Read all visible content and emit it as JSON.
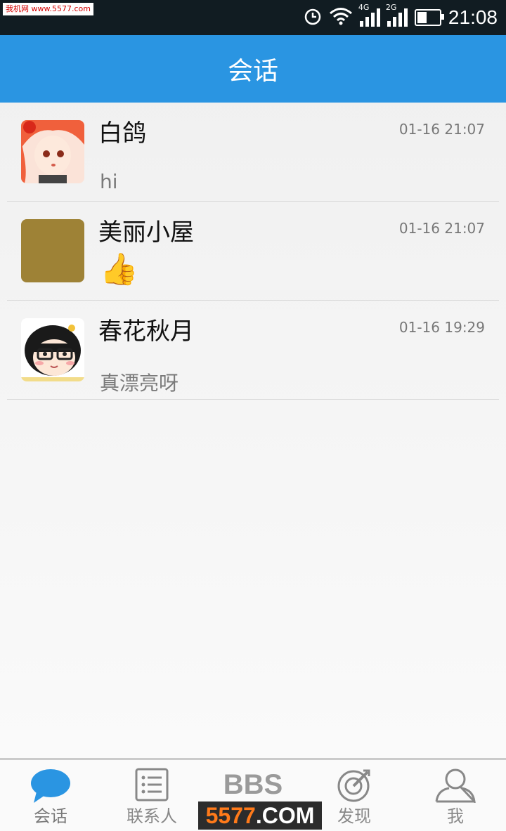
{
  "status_bar": {
    "watermark": "我机网 www.5577.com",
    "net_4g": "4G",
    "net_2g": "2G",
    "time": "21:08",
    "battery_level": 0.45
  },
  "header": {
    "title": "会话"
  },
  "conversations": [
    {
      "name": "白鸽",
      "time": "01-16 21:07",
      "message": "hi"
    },
    {
      "name": "美丽小屋",
      "time": "01-16 21:07",
      "message": "👍"
    },
    {
      "name": "春花秋月",
      "time": "01-16 19:29",
      "message": "真漂亮呀"
    }
  ],
  "tabs": [
    {
      "label": "会话",
      "icon": "chat-bubble-icon",
      "active": true
    },
    {
      "label": "联系人",
      "icon": "contacts-list-icon"
    },
    {
      "label": "BBS",
      "icon": "bbs-icon"
    },
    {
      "label": "发现",
      "icon": "discover-target-icon"
    },
    {
      "label": "我",
      "icon": "person-icon"
    }
  ],
  "watermark_bottom": {
    "number": "5577",
    "domain": ".COM"
  },
  "colors": {
    "header": "#2a95e2",
    "status_bar": "#111c22",
    "active_tab_icon": "#2a95e2"
  }
}
